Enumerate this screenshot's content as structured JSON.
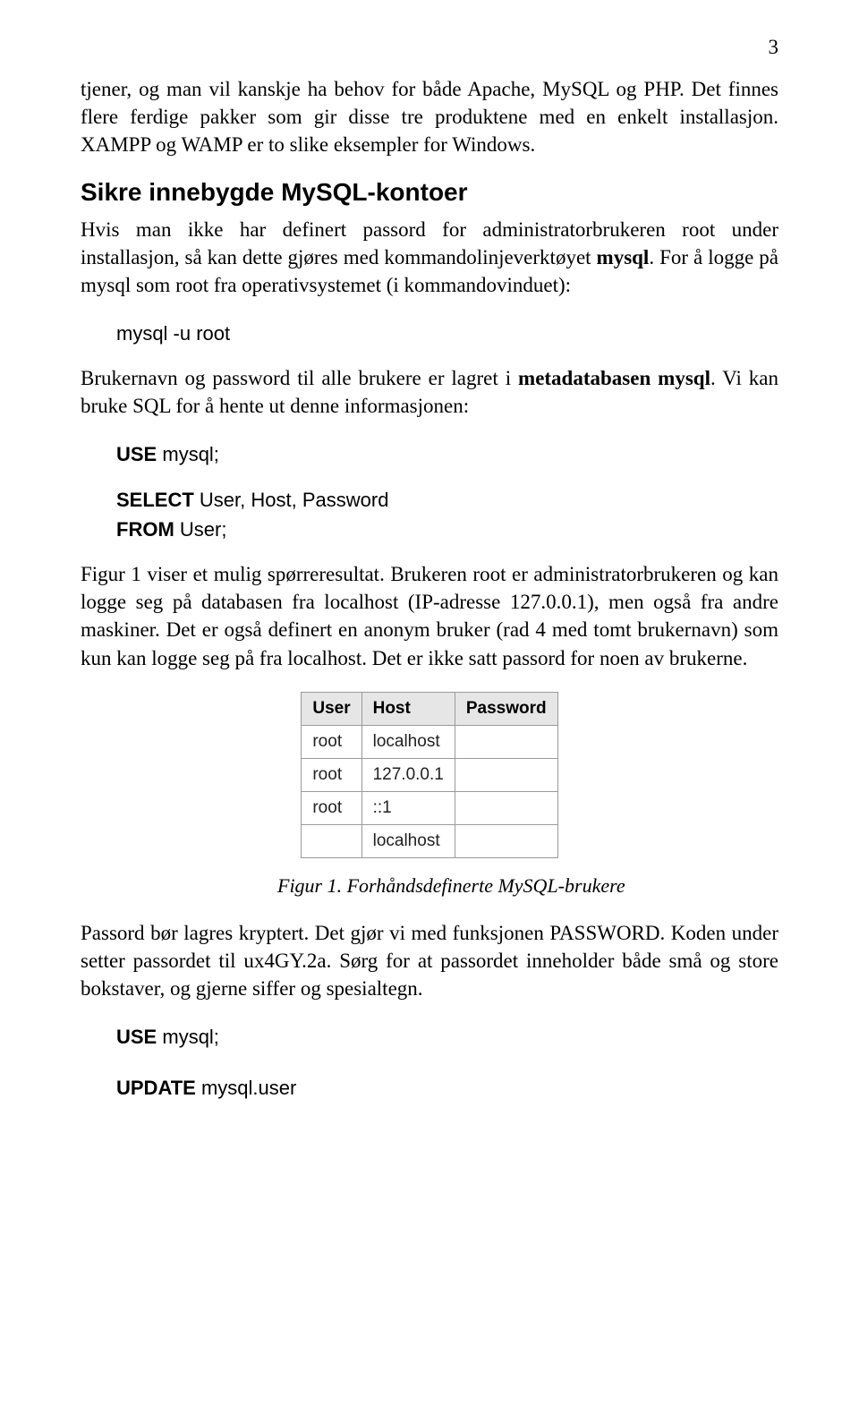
{
  "page_number": "3",
  "para1": "tjener, og man vil kanskje ha behov for både Apache, MySQL og PHP. Det finnes flere ferdige pakker som gir disse tre produktene med en enkelt installasjon. XAMPP og WAMP er to slike eksempler for Windows.",
  "heading1": "Sikre innebygde MySQL-kontoer",
  "para2_part1": "Hvis man ikke har definert passord for administratorbrukeren root under installasjon, så kan dette gjøres med kommandolinjeverktøyet ",
  "para2_bold1": "mysql",
  "para2_part2": ". For å logge på mysql som root fra operativsystemet (i kommandovinduet):",
  "code1_line1": "mysql -u root",
  "para3_part1": "Brukernavn og password til alle brukere er lagret i ",
  "para3_bold1": "metadatabasen mysql",
  "para3_part2": ". Vi kan bruke SQL for å hente ut denne informasjonen:",
  "code2_line1_bold": "USE",
  "code2_line1_rest": " mysql;",
  "code2_line2_bold": "SELECT",
  "code2_line2_rest": " User, Host, Password",
  "code2_line3_bold": "FROM",
  "code2_line3_rest": " User;",
  "para4": "Figur 1 viser et mulig spørreresultat. Brukeren root er administratorbrukeren og kan logge seg på databasen fra localhost (IP-adresse 127.0.0.1), men også fra andre maskiner. Det er også definert en anonym bruker (rad 4 med tomt brukernavn) som kun kan logge seg på fra localhost. Det er ikke satt passord for noen av brukerne.",
  "table": {
    "headers": [
      "User",
      "Host",
      "Password"
    ],
    "rows": [
      [
        "root",
        "localhost",
        ""
      ],
      [
        "root",
        "127.0.0.1",
        ""
      ],
      [
        "root",
        "::1",
        ""
      ],
      [
        "",
        "localhost",
        ""
      ]
    ]
  },
  "figure_caption": "Figur 1. Forhåndsdefinerte MySQL-brukere",
  "para5": "Passord bør lagres kryptert. Det gjør vi med funksjonen PASSWORD. Koden under setter passordet til ux4GY.2a. Sørg for at passordet inneholder både små og store bokstaver, og gjerne siffer og spesialtegn.",
  "code3_line1_bold": "USE",
  "code3_line1_rest": " mysql;",
  "code4_line1_bold": "UPDATE",
  "code4_line1_rest": " mysql.user"
}
